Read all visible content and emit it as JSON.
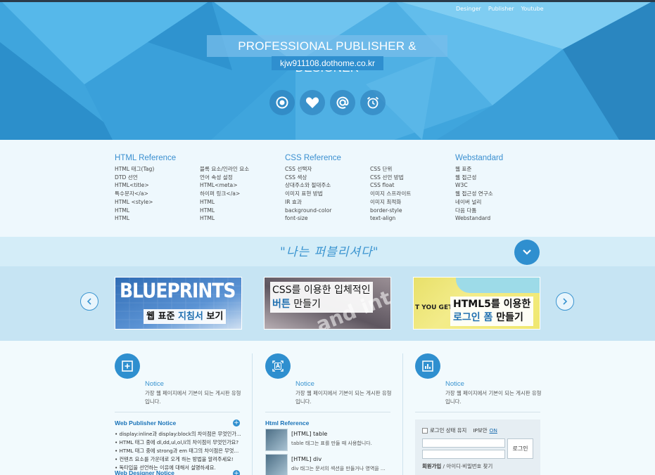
{
  "nav": {
    "items": [
      "Desinger",
      "Publisher",
      "Youtube"
    ]
  },
  "hero": {
    "title": "PROFESSIONAL PUBLISHER & DESIGNER",
    "subtitle": "kjw911108.dothome.co.kr",
    "icons": [
      "record-icon",
      "heart-icon",
      "at-sign-icon",
      "alarm-clock-icon"
    ]
  },
  "references": [
    {
      "title": "HTML Reference",
      "col1": [
        "HTML 태그(Tag)",
        "DTD 선언",
        "HTML<title>",
        "특수문자</a>",
        "HTML <style>",
        "HTML",
        "HTML"
      ],
      "col2": [
        "블록 요소/인라인 요소",
        "언어 속성 설정",
        "HTML<meta>",
        "하이퍼 링크</a>",
        "HTML",
        "HTML",
        "HTML"
      ]
    },
    {
      "title": "CSS Reference",
      "col1": [
        "CSS 선택자",
        "CSS 색상",
        "상대주소와 절대주소",
        "이미지 표현 방법",
        "IR 효과",
        "background-color",
        "font-size"
      ],
      "col2": [
        "CSS 단위",
        "CSS 선언 방법",
        "CSS float",
        "이미지 스프라이트",
        "이미지 최적화",
        "border-style",
        "text-align"
      ]
    },
    {
      "title": "Webstandard",
      "col1": [
        "웹 표준",
        "웹 접근성",
        "W3C",
        "웹 접근성 연구소",
        "네이버 널리",
        "다음 다툼",
        "Webstandard"
      ],
      "col2": []
    }
  ],
  "banner": {
    "quote": "\"나는 퍼블리셔다\""
  },
  "slider": {
    "slides": [
      {
        "art": "BLUEPRINTS",
        "cap_pre": "웹 표준 ",
        "cap_hl": "지침서",
        "cap_post": " 보기"
      },
      {
        "art": "and inte",
        "cap_line1": "CSS를 이용한 입체적인",
        "cap_hl": "버튼",
        "cap_post": " 만들기"
      },
      {
        "art": "T YOU GET",
        "cap_line1": "HTML5를 이용한",
        "cap_hl": "로그인 폼",
        "cap_post": " 만들기"
      }
    ]
  },
  "notices": [
    {
      "icon": "plus-square-icon",
      "title": "Notice",
      "text": "가장 웹 페이지에서 기본이 되는 게시판 유형입니다."
    },
    {
      "icon": "text-frame-icon",
      "title": "Notice",
      "text": "가장 웹 페이지에서 기본이 되는 게시판 유형입니다."
    },
    {
      "icon": "bar-chart-icon",
      "title": "Notice",
      "text": "가장 웹 페이지에서 기본이 되는 게시판 유형입니다."
    }
  ],
  "publisher_notice": {
    "title": "Web Publisher Notice",
    "items": [
      "• display:inline과 display:block의 차이점은 무엇인가...",
      "• HTML 태그 중에 dl,dd,ul,ol,li의 차이점이 무엇인가요?",
      "• HTML 태그 중에 strong과 em 태그의 차이점은 무엇...",
      "• 컨텐츠 요소를 가운데로 오게 하는 방법을 알려주세요!",
      "• 독타입을 선언하는 이유에 대해서 설명하세요."
    ],
    "next_title": "Web Designer Notice"
  },
  "html_reference": {
    "title": "Html Reference",
    "items": [
      {
        "title": "[HTML] table",
        "desc": "table 태그는 표를 만들 때 사용합니다."
      },
      {
        "title": "[HTML] div",
        "desc": "div 태그는 문서의 섹션을 만들거나 영역을 ..."
      }
    ]
  },
  "login": {
    "keep_label": "로그인 상태 유지",
    "ip_label": "IP보안",
    "ip_state": "ON",
    "button": "로그인",
    "join": "회원가입",
    "find": " / 아이디·비밀번호 찾기"
  },
  "colors": {
    "accent": "#2f8fcf",
    "link": "#3a94d0"
  }
}
